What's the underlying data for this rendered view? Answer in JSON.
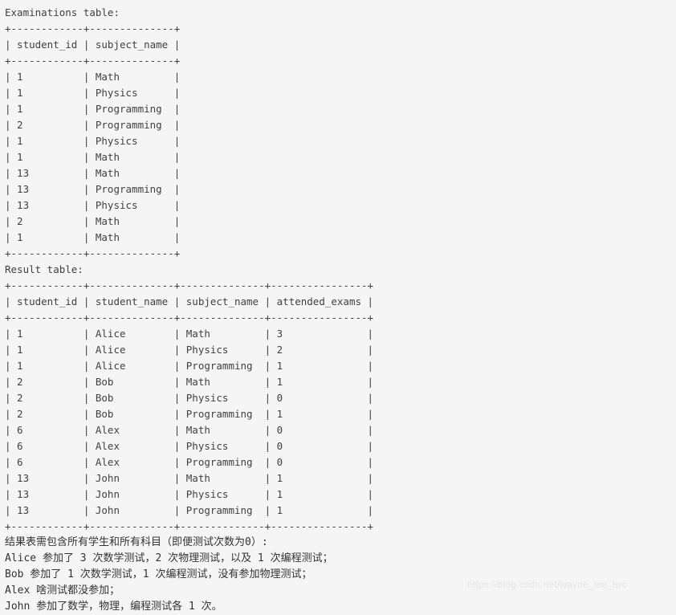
{
  "examinations": {
    "caption": "Examinations table:",
    "separator": "+------------+--------------+",
    "header": "| student_id | subject_name |",
    "rows": [
      "| 1          | Math         |",
      "| 1          | Physics      |",
      "| 1          | Programming  |",
      "| 2          | Programming  |",
      "| 1          | Physics      |",
      "| 1          | Math         |",
      "| 13         | Math         |",
      "| 13         | Programming  |",
      "| 13         | Physics      |",
      "| 2          | Math         |",
      "| 1          | Math         |"
    ]
  },
  "result": {
    "caption": "Result table:",
    "separator": "+------------+--------------+--------------+----------------+",
    "header": "| student_id | student_name | subject_name | attended_exams |",
    "rows": [
      "| 1          | Alice        | Math         | 3              |",
      "| 1          | Alice        | Physics      | 2              |",
      "| 1          | Alice        | Programming  | 1              |",
      "| 2          | Bob          | Math         | 1              |",
      "| 2          | Bob          | Physics      | 0              |",
      "| 2          | Bob          | Programming  | 1              |",
      "| 6          | Alex         | Math         | 0              |",
      "| 6          | Alex         | Physics      | 0              |",
      "| 6          | Alex         | Programming  | 0              |",
      "| 13         | John         | Math         | 1              |",
      "| 13         | John         | Physics      | 1              |",
      "| 13         | John         | Programming  | 1              |"
    ]
  },
  "explanation": {
    "lines": [
      "结果表需包含所有学生和所有科目（即便测试次数为0）:",
      "Alice 参加了 3 次数学测试，2 次物理测试，以及 1 次编程测试；",
      "Bob 参加了 1 次数学测试，1 次编程测试，没有参加物理测试；",
      "Alex 啥测试都没参加；",
      "John 参加了数学，物理，编程测试各 1 次。"
    ]
  },
  "watermark": {
    "text": "https://blog.csdn.net/wayne_lee_lwc"
  }
}
